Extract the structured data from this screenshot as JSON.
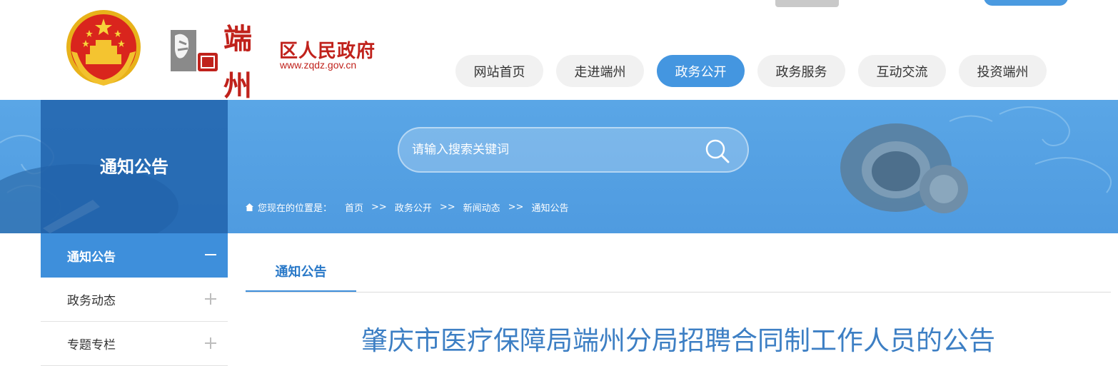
{
  "site": {
    "logo_chars": [
      "端",
      "州"
    ],
    "name": "区人民政府",
    "url": "www.zqdz.gov.cn"
  },
  "nav": [
    {
      "label": "网站首页",
      "active": false
    },
    {
      "label": "走进端州",
      "active": false
    },
    {
      "label": "政务公开",
      "active": true
    },
    {
      "label": "政务服务",
      "active": false
    },
    {
      "label": "互动交流",
      "active": false
    },
    {
      "label": "投资端州",
      "active": false
    }
  ],
  "banner": {
    "section_title": "通知公告",
    "search_placeholder": "请输入搜索关键词"
  },
  "breadcrumb": {
    "label": "您现在的位置是：",
    "items": [
      "首页",
      "政务公开",
      "新闻动态",
      "通知公告"
    ],
    "separator": ">>"
  },
  "sidebar": [
    {
      "label": "通知公告",
      "active": true,
      "sign": "minus"
    },
    {
      "label": "政务动态",
      "active": false,
      "sign": "plus"
    },
    {
      "label": "专题专栏",
      "active": false,
      "sign": "plus"
    }
  ],
  "main": {
    "tab_label": "通知公告",
    "article_title": "肇庆市医疗保障局端州分局招聘合同制工作人员的公告"
  },
  "colors": {
    "primary_blue": "#4496e0",
    "dark_blue_overlay": "#1e60aa",
    "brand_red": "#c0221c",
    "title_blue": "#3d7fc4"
  }
}
